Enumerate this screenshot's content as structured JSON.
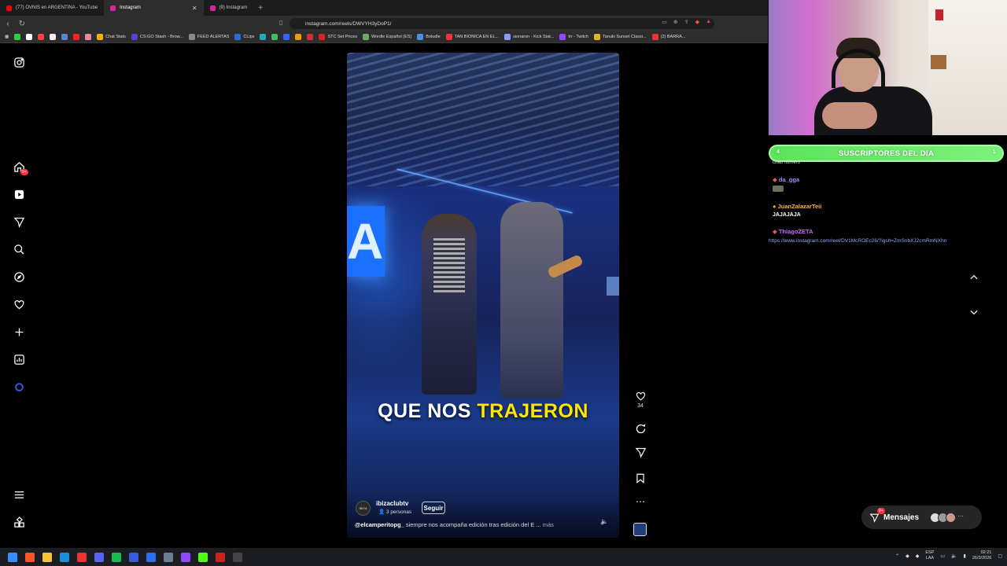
{
  "browser": {
    "tabs": [
      {
        "label": "(77) OVNIS en ARGENTINA - YouTube",
        "active": false,
        "color": "#ff0000"
      },
      {
        "label": "Instagram",
        "active": true,
        "color": "#d6249f"
      },
      {
        "label": "(9) Instagram",
        "active": false,
        "color": "#d6249f"
      }
    ],
    "url": "instagram.com/reels/DWVYH3yDoP1/",
    "bookmarks": [
      "Chat Stats",
      "CS:GO Stash - Brow...",
      "FEED ALERTAS",
      "CLips",
      "STC Set Prices",
      "Wordle Español (ES)",
      "Boludle",
      "TAN BIONICA EN EL...",
      "sionaron - Kick Stat...",
      "trr - Twitch",
      "Tanuki Sunset Classi...",
      "(2) BARRA..."
    ]
  },
  "sidebar": {
    "notif_badge": "9+",
    "icons": [
      "instagram-logo-icon",
      "home-icon",
      "reels-icon",
      "send-icon",
      "search-icon",
      "explore-icon",
      "heart-icon",
      "create-icon",
      "dashboard-icon",
      "meta-ai-icon",
      "menu-icon",
      "apps-icon"
    ]
  },
  "reel": {
    "caption_white": "QUE NOS",
    "caption_highlight": "TRAJERON",
    "account": {
      "name": "ibizaclubtv",
      "avatar_text": "IBIZA",
      "followers": "3 personas"
    },
    "follow_label": "Seguir",
    "description_user": "@elcamperitopg_",
    "description_text": " siempre nos acompaña edición tras edición del E ...",
    "description_more": "más",
    "likes": "34"
  },
  "messages": {
    "label": "Mensajes",
    "badge": "9+"
  },
  "stream_overlay": {
    "subs_title": "SUSCRIPTORES DEL DIA",
    "subs_left": "4",
    "subs_right": "1",
    "chat_partial": "chau número",
    "chat": [
      {
        "user": "da_gga",
        "color": "#a58cff",
        "message": ""
      },
      {
        "user": "JuanZalazarTeii",
        "color": "#ffb347",
        "message": "JAJAJAJA"
      },
      {
        "user": "ThiagoZETA",
        "color": "#c86bff",
        "message": ""
      }
    ],
    "chat_link": "https://www.instagram.com/reel/DV1McROEc26/?igsh=ZmSnbXJ2cmRmNXhn"
  },
  "taskbar": {
    "lang": [
      "ESP",
      "LAA"
    ],
    "time": "02:21",
    "date": "26/3/2026"
  }
}
